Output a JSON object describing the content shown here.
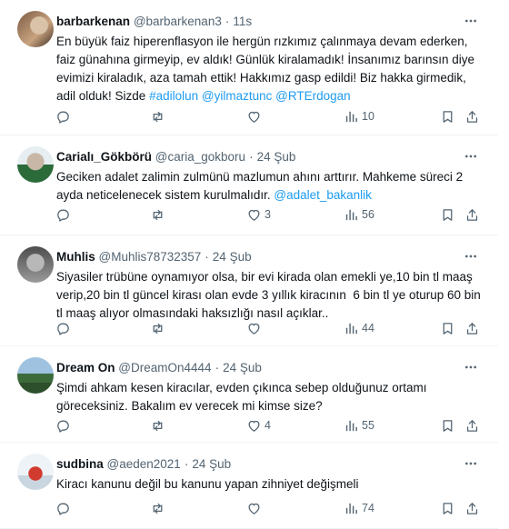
{
  "tweets": [
    {
      "name": "barbarkenan",
      "handle": "@barbarkenan3",
      "time": "11s",
      "body": "En büyük faiz hiperenflasyon ile hergün rızkımız çalınmaya devam ederken, faiz günahına girmeyip, ev aldık! Günlük kiralamadık! İnsanımız barınsın diye evimizi kiraladık, aza tamah ettik! Hakkımız gasp edildi! Biz hakka girmedik, adil olduk! Sizde ",
      "links": [
        "#adilolun",
        "@yilmaztunc",
        "@RTErdogan"
      ],
      "replies": "",
      "retweets": "",
      "likes": "",
      "views": "10"
    },
    {
      "name": "Carialı_Gökbörü",
      "handle": "@caria_gokboru",
      "time": "24 Şub",
      "body": "Geciken adalet zalimin zulmünü mazlumun ahını arttırır. Mahkeme süreci 2 ayda neticelenecek sistem kurulmalıdır. ",
      "links": [
        "@adalet_bakanlik"
      ],
      "replies": "",
      "retweets": "",
      "likes": "3",
      "views": "56"
    },
    {
      "name": "Muhlis",
      "handle": "@Muhlis78732357",
      "time": "24 Şub",
      "body": "Siyasiler trübüne oynamıyor olsa, bir evi kirada olan emekli ye,10 bin tl maaş verip,20 bin tl güncel kirası olan evde 3 yıllık kiracının  6 bin tl ye oturup 60 bin tl maaş alıyor olmasındaki haksızlığı nasıl açıklar..",
      "links": [],
      "replies": "",
      "retweets": "",
      "likes": "",
      "views": "44"
    },
    {
      "name": "Dream On",
      "handle": "@DreamOn4444",
      "time": "24 Şub",
      "body": "Şimdi ahkam kesen kiracılar, evden çıkınca sebep olduğunuz ortamı göreceksiniz. Bakalım ev verecek mi kimse size?",
      "links": [],
      "replies": "",
      "retweets": "",
      "likes": "4",
      "views": "55"
    },
    {
      "name": "sudbina",
      "handle": "@aeden2021",
      "time": "24 Şub",
      "body": "Kiracı kanunu değil bu kanunu yapan zihniyet değişmeli",
      "links": [],
      "replies": "",
      "retweets": "",
      "likes": "",
      "views": "74"
    }
  ],
  "separator": "·",
  "icons": {
    "more": "more-horizontal-icon",
    "reply": "reply-icon",
    "retweet": "retweet-icon",
    "like": "heart-icon",
    "views": "views-bar-chart-icon",
    "bookmark": "bookmark-icon",
    "share": "share-upload-icon"
  },
  "colors": {
    "text": "#0f1419",
    "secondary": "#536471",
    "link": "#1d9bf0",
    "divider": "#eff3f4"
  }
}
